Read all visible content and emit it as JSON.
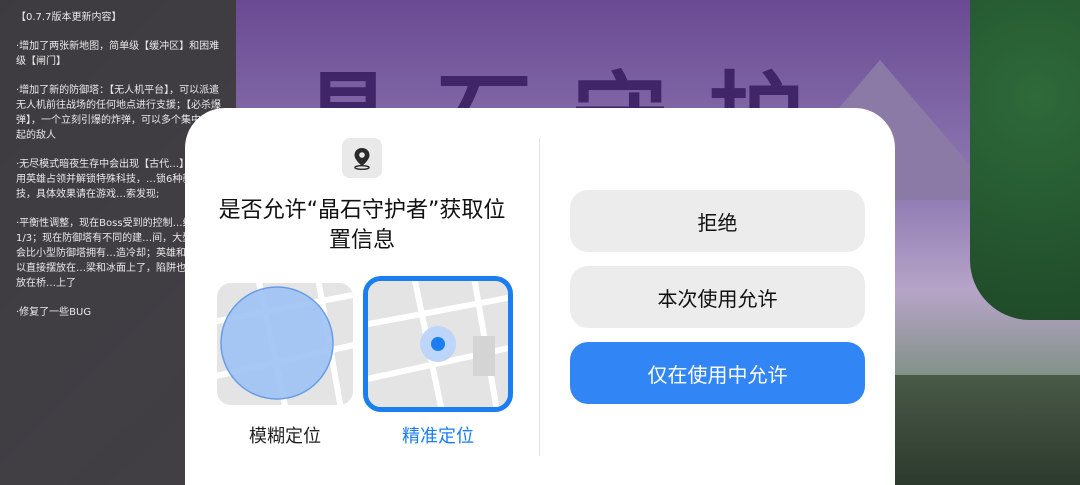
{
  "notes": {
    "paragraphs": [
      "【0.7.7版本更新内容】",
      "·增加了两张新地图，简单级【缓冲区】和困难级【闸门】",
      "·增加了新的防御塔：【无人机平台】，可以派遣无人机前往战场的任何地点进行支援；【必杀爆弹】，一个立刻引爆的炸弹，可以多个集中在一起的敌人",
      "·无尽模式暗夜生存中会出现【古代…】，可以用英雄占领并解锁特殊科技，…锁6种新的科技，具体效果请在游戏…索发现;",
      "·平衡性调整，现在Boss受到的控制…缩减至1/3；现在防御塔有不同的建…间，大型防御塔会比小型防御塔拥有…造冷却；英雄和机甲可以直接摆放在…梁和冰面上了，陷阱也可以摆放在桥…上了",
      "·修复了一些BUG"
    ]
  },
  "dialog": {
    "title": "是否允许“晶石守护者”获取位置信息",
    "approx_label": "模糊定位",
    "precise_label": "精准定位",
    "buttons": {
      "deny": "拒绝",
      "allow_once": "本次使用允许",
      "allow_while_using": "仅在使用中允许"
    }
  },
  "colors": {
    "accent": "#3285f5",
    "selected_border": "#1a7ef0"
  }
}
